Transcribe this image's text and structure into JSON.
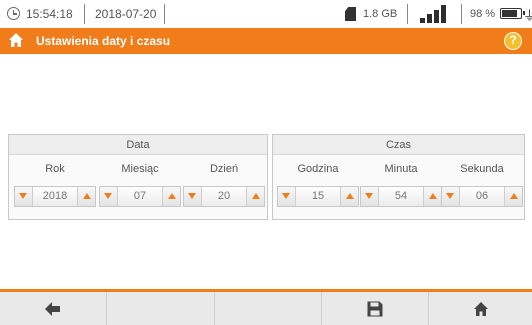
{
  "status_bar": {
    "time": "15:54:18",
    "date": "2018-07-20",
    "storage": "1.8 GB",
    "signal_bars": 4,
    "battery": "98 %",
    "battery_level": 0.98,
    "icons": [
      "clock-icon",
      "sd-card-icon",
      "signal-icon",
      "battery-icon",
      "plug-icon"
    ]
  },
  "header": {
    "title": "Ustawienia daty i czasu",
    "icons": [
      "home-icon",
      "help-icon"
    ],
    "accent_color": "#f07d1a"
  },
  "date_panel": {
    "title": "Data",
    "fields": [
      {
        "label": "Rok",
        "value": "2018"
      },
      {
        "label": "Miesiąc",
        "value": "07"
      },
      {
        "label": "Dzień",
        "value": "20"
      }
    ]
  },
  "time_panel": {
    "title": "Czas",
    "fields": [
      {
        "label": "Godzina",
        "value": "15"
      },
      {
        "label": "Minuta",
        "value": "54"
      },
      {
        "label": "Sekunda",
        "value": "06"
      }
    ]
  },
  "bottom_bar": {
    "buttons": [
      {
        "name": "back",
        "icon": "back-arrow-icon"
      },
      {
        "name": "empty-2",
        "icon": ""
      },
      {
        "name": "empty-3",
        "icon": ""
      },
      {
        "name": "save",
        "icon": "save-icon"
      },
      {
        "name": "home",
        "icon": "home-icon"
      }
    ]
  }
}
